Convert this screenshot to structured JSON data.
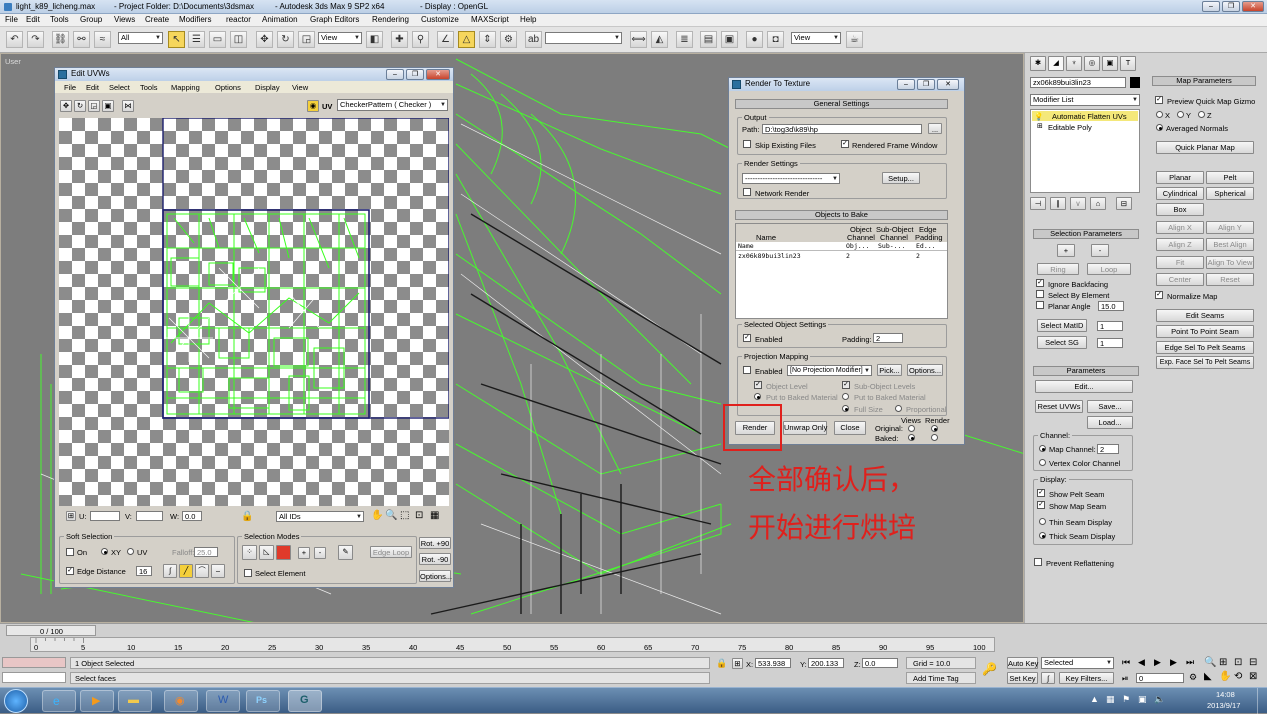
{
  "titlebar": {
    "file": "light_k89_licheng.max",
    "project": "- Project Folder: D:\\Documents\\3dsmax",
    "app": "- Autodesk 3ds Max 9 SP2 x64",
    "display": "- Display : OpenGL"
  },
  "menu": [
    "File",
    "Edit",
    "Tools",
    "Group",
    "Views",
    "Create",
    "Modifiers",
    "reactor",
    "Animation",
    "Graph Editors",
    "Rendering",
    "Customize",
    "MAXScript",
    "Help"
  ],
  "toolbar": {
    "filter": "All",
    "refcoord": "View",
    "refcoord2": "View",
    "named_sel": ""
  },
  "viewport": {
    "label": "User"
  },
  "uvw": {
    "title": "Edit UVWs",
    "menu": [
      "File",
      "Edit",
      "Select",
      "Tools",
      "Mapping",
      "Options",
      "Display",
      "View"
    ],
    "uv_toggle": "UV",
    "texture": "CheckerPattern  ( Checker )",
    "u_label": "U:",
    "v_label": "V:",
    "w_label": "W:",
    "w_value": "0.0",
    "ids": "All IDs",
    "soft_sel": {
      "title": "Soft Selection",
      "on": "On",
      "xy": "XY",
      "uv": "UV",
      "falloff": "Falloff:",
      "falloff_val": "25.0",
      "edge": "Edge Distance",
      "edge_val": "16"
    },
    "sel_modes": {
      "title": "Selection Modes",
      "edge_loop": "Edge Loop",
      "select_element": "Select Element"
    },
    "rot_p90": "Rot. +90",
    "rot_m90": "Rot. -90",
    "options": "Options..."
  },
  "rtt": {
    "title": "Render To Texture",
    "general": "General Settings",
    "output": "Output",
    "path_label": "Path:",
    "path": "D:\\tog3d\\k89\\hp",
    "skip": "Skip Existing Files",
    "rendered_frame": "Rendered Frame Window",
    "render_settings": "Render Settings",
    "setup": "Setup...",
    "network": "Network Render",
    "objects": "Objects to Bake",
    "col_name": "Name",
    "col_obj": [
      "Object",
      "Channel"
    ],
    "col_sub": [
      "Sub-Object",
      "Channel"
    ],
    "col_edge": [
      "Edge",
      "Padding"
    ],
    "hdr_row": [
      "Name",
      "Obj...",
      "Sub-...",
      "Ed..."
    ],
    "row": [
      "zx06k89bui3lin23",
      "2",
      "",
      "2"
    ],
    "sel_settings": "Selected Object Settings",
    "enabled": "Enabled",
    "padding": "Padding:",
    "padding_val": "2",
    "proj": "Projection Mapping",
    "proj_enabled": "Enabled",
    "proj_mod": "[No Projection Modifier]",
    "pick": "Pick...",
    "options": "Options...",
    "obj_level": "Object Level",
    "sub_level": "Sub-Object Levels",
    "put_baked": "Put to Baked Material",
    "put_baked2": "Put to Baked Material",
    "full_size": "Full Size",
    "proportional": "Proportional",
    "render": "Render",
    "unwrap": "Unwrap Only",
    "close": "Close",
    "views": "Views",
    "render_col": "Render",
    "original": "Original:",
    "baked": "Baked:"
  },
  "annotation": {
    "line1": "全部确认后，",
    "line2": "开始进行烘培"
  },
  "cmd": {
    "object_name": "zx06k89bui3lin23",
    "modifier_list": "Modifier List",
    "stack": [
      "Automatic Flatten UVs",
      "Editable Poly"
    ],
    "map_params": "Map Parameters",
    "preview": "Preview Quick Map Gizmo",
    "x": "X",
    "y": "Y",
    "z": "Z",
    "avg": "Averaged Normals",
    "quick_planar": "Quick Planar Map",
    "planar": "Planar",
    "pelt": "Pelt",
    "cylindrical": "Cylindrical",
    "spherical": "Spherical",
    "box": "Box",
    "align_x": "Align X",
    "align_y": "Align Y",
    "align_z": "Align Z",
    "best_align": "Best Align",
    "fit": "Fit",
    "align_view": "Align To View",
    "center": "Center",
    "reset": "Reset",
    "normalize": "Normalize Map",
    "edit_seams": "Edit Seams",
    "p2p": "Point To Point Seam",
    "edge_sel": "Edge Sel To Pelt Seams",
    "exp_face": "Exp. Face Sel To Pelt Seams",
    "sel_params": "Selection Parameters",
    "plus": "+",
    "minus": "-",
    "ring": "Ring",
    "loop": "Loop",
    "ignore_bf": "Ignore Backfacing",
    "by_elem": "Select By Element",
    "planar_angle": "Planar Angle",
    "angle_val": "15.0",
    "sel_matid": "Select MatID",
    "matid_val": "1",
    "sel_sg": "Select SG",
    "sg_val": "1",
    "parameters": "Parameters",
    "edit": "Edit...",
    "reset_uvws": "Reset UVWs",
    "save": "Save...",
    "load": "Load...",
    "channel": "Channel:",
    "map_channel": "Map Channel:",
    "map_channel_val": "2",
    "vertex_color": "Vertex Color Channel",
    "display": "Display:",
    "show_pelt": "Show Pelt Seam",
    "show_map": "Show Map Seam",
    "thin": "Thin Seam Display",
    "thick": "Thick Seam Display",
    "prevent": "Prevent Reflattening"
  },
  "timeline": {
    "slider": "0 / 100",
    "ticks": [
      "0",
      "5",
      "10",
      "15",
      "20",
      "25",
      "30",
      "35",
      "40",
      "45",
      "50",
      "55",
      "60",
      "65",
      "70",
      "75",
      "80",
      "85",
      "90",
      "95",
      "100"
    ]
  },
  "status": {
    "selected": "1 Object Selected",
    "prompt": "Select faces",
    "x": "533.938",
    "y": "200.133",
    "z": "0.0",
    "grid": "Grid = 10.0",
    "add_time": "Add Time Tag",
    "auto_key": "Auto Key",
    "selected_dd": "Selected",
    "set_key": "Set Key",
    "key_filters": "Key Filters...",
    "frame": "0"
  },
  "clock": {
    "time": "14:08",
    "date": "2013/9/17"
  }
}
